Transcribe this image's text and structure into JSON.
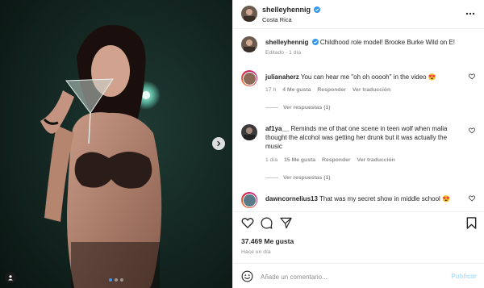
{
  "post": {
    "author": "shelleyhennig",
    "location": "Costa Rica",
    "verified": true,
    "caption": "Childhood role model! Brooke Burke Wild on E!",
    "caption_meta": "Editado · 1 día",
    "likes": "37.469 Me gusta",
    "time_ago": "Hace un día"
  },
  "photo": {
    "slide_count": 3,
    "active_slide": 0
  },
  "comments": [
    {
      "user": "julianaherz",
      "text": "You can hear me \"oh oh ooooh\" in the video 😍",
      "time": "17 h",
      "likes": "4 Me gusta",
      "reply": "Responder",
      "translate": "Ver traducción",
      "view_replies": "Ver respuestas (1)"
    },
    {
      "user": "af1ya__",
      "text": "Reminds me of that one scene in teen wolf when malia thought the alcohol was getting her drunk but it was actually the music",
      "time": "1 día",
      "likes": "15 Me gusta",
      "reply": "Responder",
      "translate": "Ver traducción",
      "view_replies": "Ver respuestas (1)"
    },
    {
      "user": "dawncornelius13",
      "text": "That was my secret show in middle school 😍",
      "time": "",
      "likes": "",
      "reply": "",
      "translate": "",
      "view_replies": ""
    }
  ],
  "composer": {
    "placeholder": "Añade un comentario...",
    "submit": "Publicar"
  },
  "colors": {
    "verified": "#3897f0",
    "active_dot": "#4a90e2",
    "publish_disabled": "#b2dffc"
  },
  "icons": [
    "more-icon",
    "heart-icon",
    "comment-icon",
    "share-icon",
    "bookmark-icon",
    "emoji-icon",
    "chevron-right-icon",
    "user-tag-icon"
  ]
}
